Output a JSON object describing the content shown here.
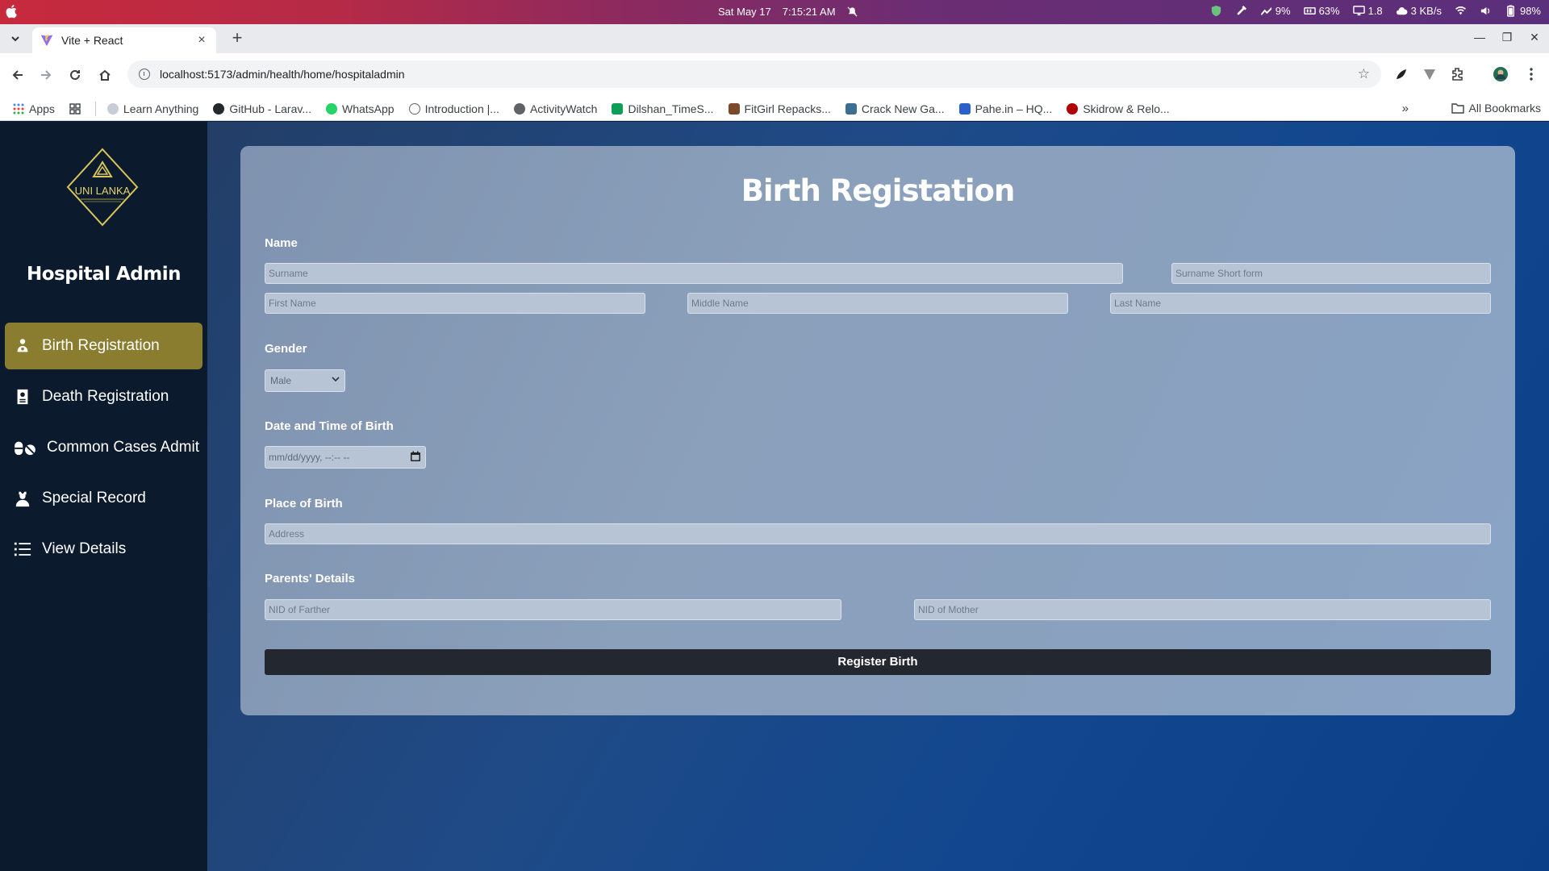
{
  "os": {
    "date": "Sat May 17",
    "time": "7:15:21 AM",
    "tray": {
      "cpu": "9%",
      "mem": "63%",
      "load": "1.8",
      "net": "3 KB/s",
      "battery": "98%"
    }
  },
  "browser": {
    "tab_title": "Vite + React",
    "url": "localhost:5173/admin/health/home/hospitaladmin",
    "bookmarks": [
      "Apps",
      "Learn Anything",
      "GitHub - Larav...",
      "WhatsApp",
      "Introduction |...",
      "ActivityWatch",
      "Dilshan_TimeS...",
      "FitGirl Repacks...",
      "Crack New Ga...",
      "Pahe.in – HQ...",
      "Skidrow & Relo..."
    ],
    "all_bookmarks": "All Bookmarks",
    "bookmark_colors": [
      "#4a7bd0",
      "#24292e",
      "#25d366",
      "#5f6368",
      "#5f6368",
      "#0f9d58",
      "#7b4a2a",
      "#3b6e91",
      "#2a60c9",
      "#b00000"
    ]
  },
  "sidebar": {
    "title": "Hospital Admin",
    "logo_text": "UNI LANKA",
    "items": [
      {
        "label": "Birth Registration",
        "icon": "baby-icon",
        "active": true
      },
      {
        "label": "Death Registration",
        "icon": "certificate-icon",
        "active": false
      },
      {
        "label": "Common Cases Admit",
        "icon": "pills-icon",
        "active": false
      },
      {
        "label": "Special Record",
        "icon": "user-nurse-icon",
        "active": false
      },
      {
        "label": "View Details",
        "icon": "list-icon",
        "active": false
      }
    ],
    "accent_color": "#8a7d2f"
  },
  "form": {
    "title": "Birth Registation",
    "name_label": "Name",
    "surname_ph": "Surname",
    "surname_short_ph": "Surname Short form",
    "first_name_ph": "First Name",
    "middle_name_ph": "Middle Name",
    "last_name_ph": "Last Name",
    "gender_label": "Gender",
    "gender_value": "Male",
    "dob_label": "Date and Time of Birth",
    "dob_ph": "mm/dd/yyyy, --:-- --",
    "place_label": "Place of Birth",
    "address_ph": "Address",
    "parents_label": "Parents' Details",
    "father_ph": "NID of Farther",
    "mother_ph": "NID of Mother",
    "submit": "Register Birth"
  }
}
